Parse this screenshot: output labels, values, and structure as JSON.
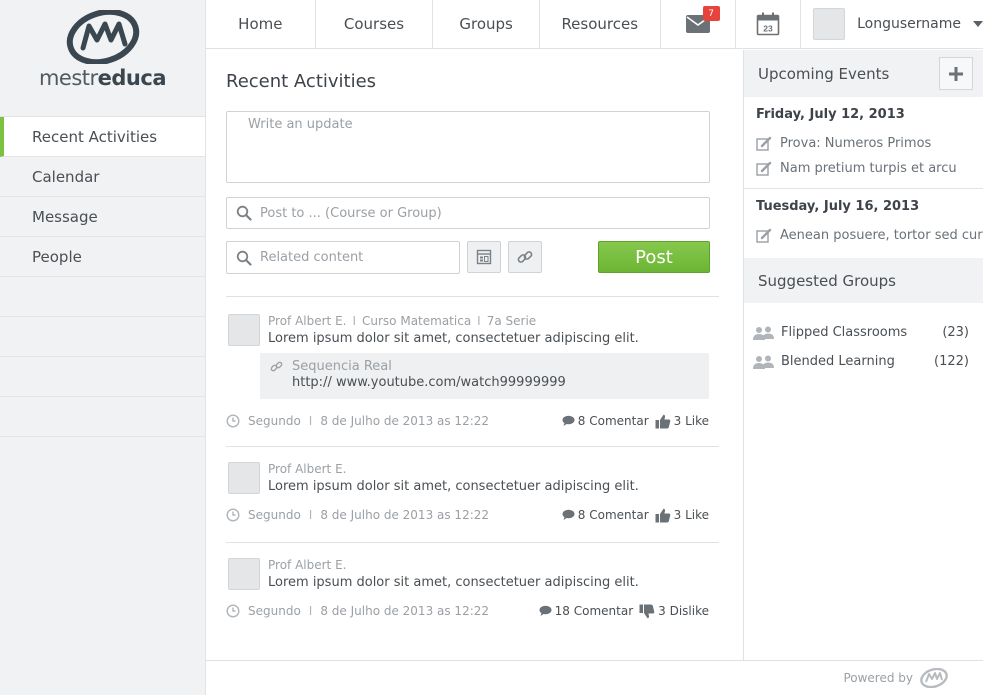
{
  "brand": {
    "logo_light": "mestr",
    "logo_bold": "educa",
    "accent": "#7cc242"
  },
  "sidebar": {
    "items": [
      {
        "label": "Recent Activities",
        "active": true
      },
      {
        "label": "Calendar"
      },
      {
        "label": "Message"
      },
      {
        "label": "People"
      }
    ]
  },
  "topnav": {
    "home": "Home",
    "courses": "Courses",
    "groups": "Groups",
    "resources": "Resources",
    "mail_badge": "7",
    "calendar_day": "23",
    "username": "Longusername"
  },
  "main": {
    "title": "Recent Activities",
    "update_placeholder": "Write an update",
    "post_to_placeholder": "Post to ... (Course or Group)",
    "related_placeholder": "Related content",
    "post_label": "Post",
    "feed": [
      {
        "author": "Prof Albert E.",
        "course": "Curso Matematica",
        "grade": "7a Serie",
        "text": "Lorem ipsum dolor sit amet, consectetuer adipiscing elit.",
        "attachment_title": "Sequencia Real",
        "attachment_url": "http:// www.youtube.com/watch99999999",
        "time_ago": "Segundo",
        "date": "8 de Julho de 2013 as 12:22",
        "comments": "8 Comentar",
        "reaction": "3 Like"
      },
      {
        "author": "Prof Albert E.",
        "text": "Lorem ipsum dolor sit amet, consectetuer adipiscing elit.",
        "time_ago": "Segundo",
        "date": "8 de Julho de 2013 as 12:22",
        "comments": "8 Comentar",
        "reaction": "3 Like"
      },
      {
        "author": "Prof Albert E.",
        "text": "Lorem ipsum dolor sit amet, consectetuer adipiscing elit.",
        "time_ago": "Segundo",
        "date": "8 de Julho de 2013 as 12:22",
        "comments": "18 Comentar",
        "reaction": "3 Dislike"
      }
    ]
  },
  "events": {
    "title": "Upcoming Events",
    "groups": [
      {
        "date": "Friday, July 12, 2013",
        "items": [
          "Prova: Numeros Primos",
          "Nam pretium turpis et arcu"
        ]
      },
      {
        "date": "Tuesday, July 16, 2013",
        "items": [
          "Aenean posuere, tortor sed cur"
        ]
      }
    ]
  },
  "suggested": {
    "title": "Suggested Groups",
    "groups": [
      {
        "name": "Flipped Classrooms",
        "count": "(23)"
      },
      {
        "name": "Blended Learning",
        "count": "(122)"
      }
    ]
  },
  "footer": {
    "powered_by": "Powered by"
  }
}
